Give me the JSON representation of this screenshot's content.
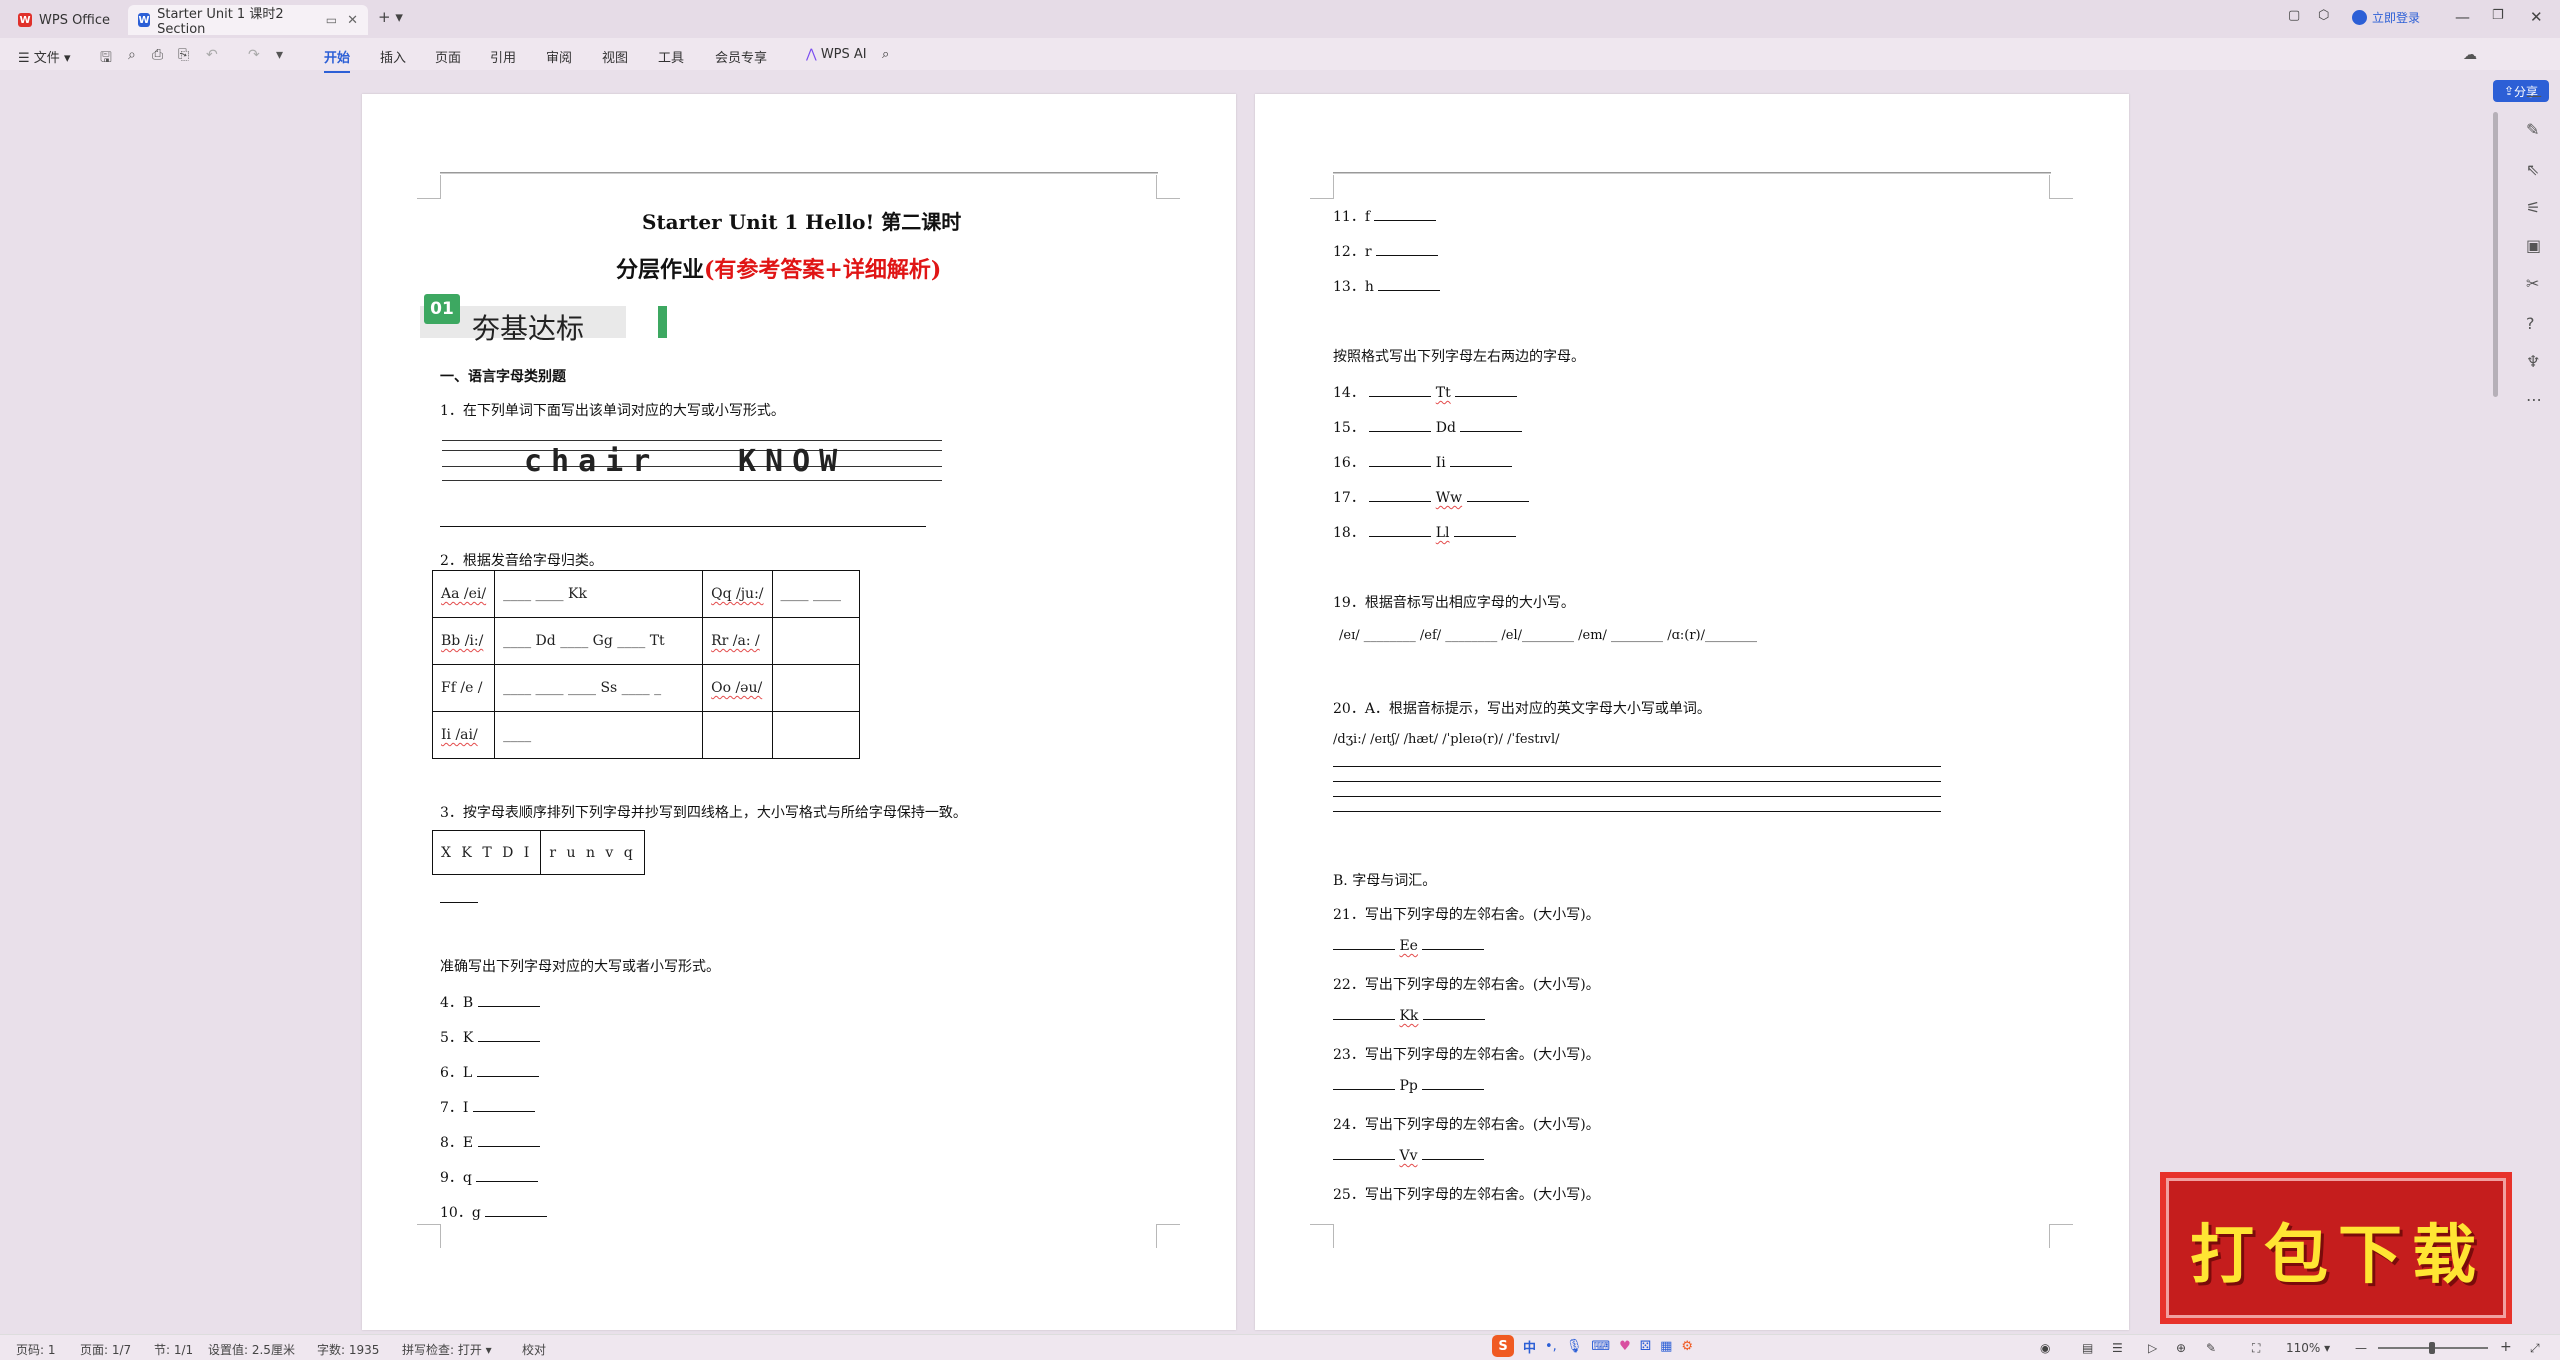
{
  "titlebar": {
    "tabs": [
      {
        "label": "WPS Office",
        "active": false
      },
      {
        "label": "Starter Unit 1 课时2 Section",
        "active": true
      }
    ],
    "new_tab": "+",
    "login": "立即登录"
  },
  "menubar": {
    "file_label": "文件",
    "items": [
      "开始",
      "插入",
      "页面",
      "引用",
      "审阅",
      "视图",
      "工具",
      "会员专享"
    ],
    "active_item": "开始",
    "ai_label": "WPS AI",
    "share_label": "分享"
  },
  "page1": {
    "title1": "Starter Unit 1 Hello!  第二课时",
    "title2_black": "分层作业",
    "title2_red": "(有参考答案+详细解析)",
    "badge_num": "01",
    "badge_text": "夯基达标",
    "section1": "一、语言字母类别题",
    "q1": "1．在下列单词下面写出该单词对应的大写或小写形式。",
    "q1_word1": "chair",
    "q1_word2": "KNOW",
    "q2": "2．根据发音给字母归类。",
    "table_rows": [
      [
        "Aa /ei/",
        "____  ____  Kk",
        "Qq /ju:/",
        "____  ____"
      ],
      [
        "Bb /i:/",
        "____  Dd  ____  Gg  ____  Tt",
        "Rr /a: /",
        ""
      ],
      [
        "Ff /e /",
        "____  ____  ____  Ss  ____  _",
        "Oo /əu/",
        ""
      ],
      [
        "Ii /ai/",
        "____",
        "",
        ""
      ]
    ],
    "q3": "3．按字母表顺序排列下列字母并抄写到四线格上，大小写格式与所给字母保持一致。",
    "q3_box1": "X K T D I",
    "q3_box2": "r u n v q",
    "section2": "准确写出下列字母对应的大写或者小写形式。",
    "items": [
      "4．B",
      "5．K",
      "6．L",
      "7．I",
      "8．E",
      "9．q",
      "10．g"
    ]
  },
  "page2": {
    "items_a": [
      "11．f",
      "12．r",
      "13．h"
    ],
    "instr1": "按照格式写出下列字母左右两边的字母。",
    "items_b": [
      {
        "num": "14．",
        "letter": "Tt"
      },
      {
        "num": "15．",
        "letter": "Dd"
      },
      {
        "num": "16．",
        "letter": "Ii"
      },
      {
        "num": "17．",
        "letter": "Ww"
      },
      {
        "num": "18．",
        "letter": "Ll"
      }
    ],
    "q19": "19．根据音标写出相应字母的大小写。",
    "q19_line": "/eɪ/  ________  /ef/  ________  /el/________  /em/  ________  /ɑ:(r)/________",
    "q20": "20．A．根据音标提示，写出对应的英文字母大小写或单词。",
    "q20_line": "/dʒi:/     /eɪtʃ/     /hæt/     /ˈpleɪə(r)/     /ˈfestɪvl/",
    "partB": "B.  字母与词汇。",
    "q_items": [
      {
        "q": "21．写出下列字母的左邻右舍。(大小写)。",
        "letter": "Ee"
      },
      {
        "q": "22．写出下列字母的左邻右舍。(大小写)。",
        "letter": "Kk"
      },
      {
        "q": "23．写出下列字母的左邻右舍。(大小写)。",
        "letter": "Pp"
      },
      {
        "q": "24．写出下列字母的左邻右舍。(大小写)。",
        "letter": "Vv"
      }
    ],
    "q25": "25．写出下列字母的左邻右舍。(大小写)。"
  },
  "statusbar": {
    "page_num": "页码: 1",
    "pages": "页面: 1/7",
    "section": "节: 1/1",
    "setting": "设置值: 2.5厘米",
    "words": "字数: 1935",
    "spell": "拼写检查: 打开",
    "proof": "校对",
    "zoom": "110%"
  },
  "ime": {
    "logo": "S",
    "lang": "中"
  },
  "download_banner": "打包下载"
}
